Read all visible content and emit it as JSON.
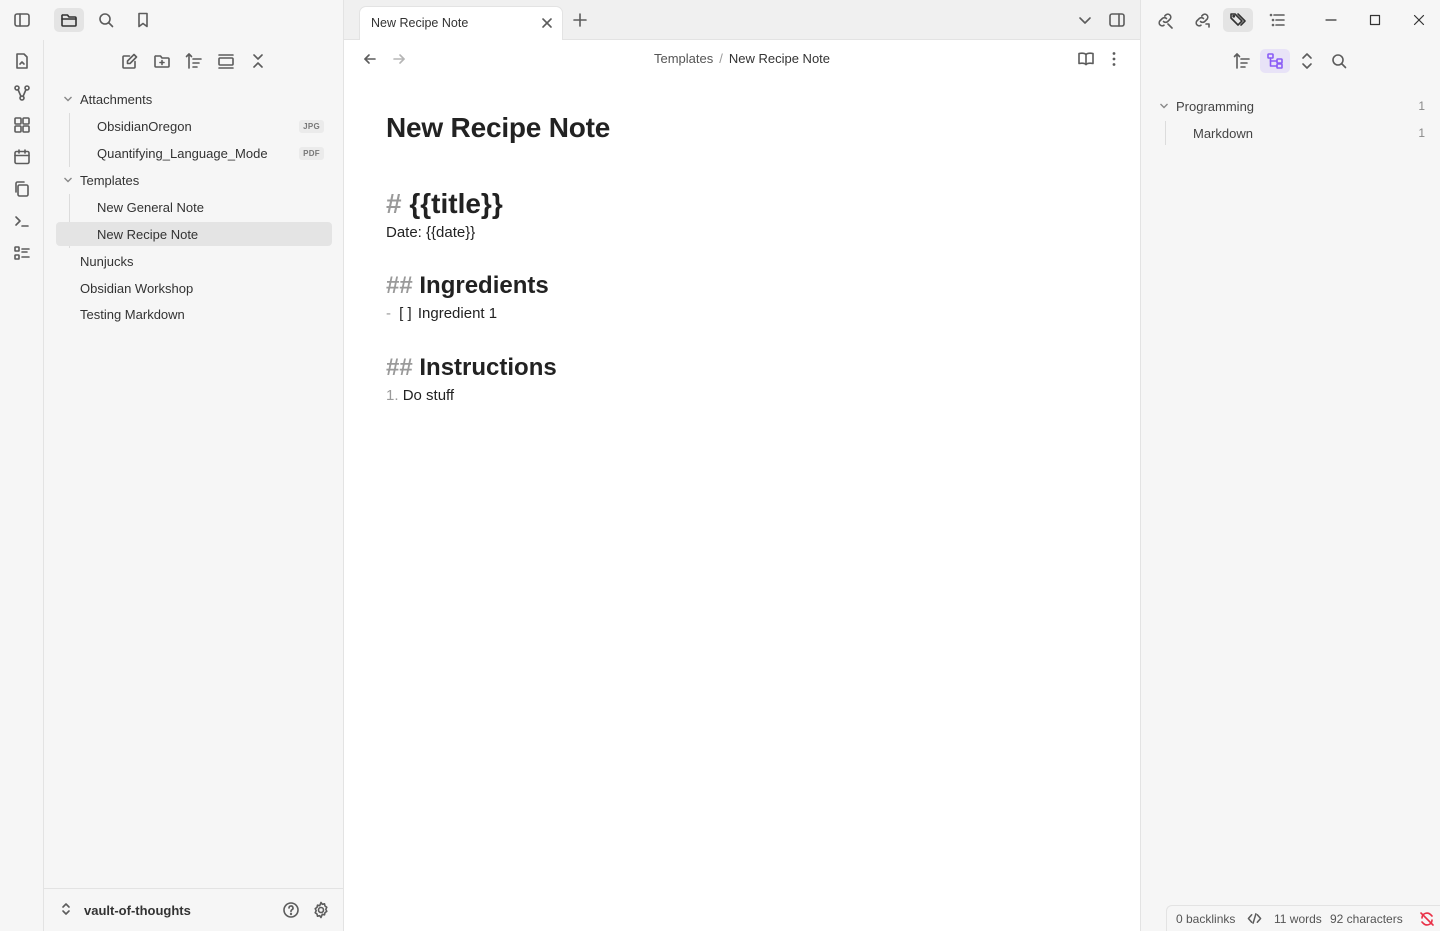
{
  "file_explorer": {
    "items": [
      {
        "label": "Attachments",
        "type": "folder",
        "expanded": true
      },
      {
        "label": "ObsidianOregon",
        "type": "file",
        "badge": "JPG"
      },
      {
        "label": "Quantifying_Language_Mode",
        "type": "file",
        "badge": "PDF"
      },
      {
        "label": "Templates",
        "type": "folder",
        "expanded": true
      },
      {
        "label": "New General Note",
        "type": "file"
      },
      {
        "label": "New Recipe Note",
        "type": "file",
        "active": true
      },
      {
        "label": "Nunjucks",
        "type": "file"
      },
      {
        "label": "Obsidian Workshop",
        "type": "file"
      },
      {
        "label": "Testing Markdown",
        "type": "file"
      }
    ],
    "vault_name": "vault-of-thoughts"
  },
  "tab": {
    "title": "New Recipe Note"
  },
  "breadcrumb": {
    "parent": "Templates",
    "separator": "/",
    "current": "New Recipe Note"
  },
  "document": {
    "title": "New Recipe Note",
    "lines": {
      "h1_mark": "#",
      "h1_text": "{{title}}",
      "date_line": "Date: {{date}}",
      "h2a_mark": "##",
      "h2a_text": "Ingredients",
      "task_dash": "-",
      "task_box": "[  ]",
      "task_text": "Ingredient 1",
      "h2b_mark": "##",
      "h2b_text": "Instructions",
      "ol_num": "1.",
      "ol_text": "Do stuff"
    }
  },
  "tags_pane": {
    "tags": [
      {
        "name": "Programming",
        "count": "1"
      },
      {
        "name": "Markdown",
        "count": "1"
      }
    ]
  },
  "status_bar": {
    "backlinks": "0 backlinks",
    "words": "11 words",
    "characters": "92 characters"
  },
  "colors": {
    "accent": "#8a5cf5",
    "sync_error": "#e93147"
  }
}
